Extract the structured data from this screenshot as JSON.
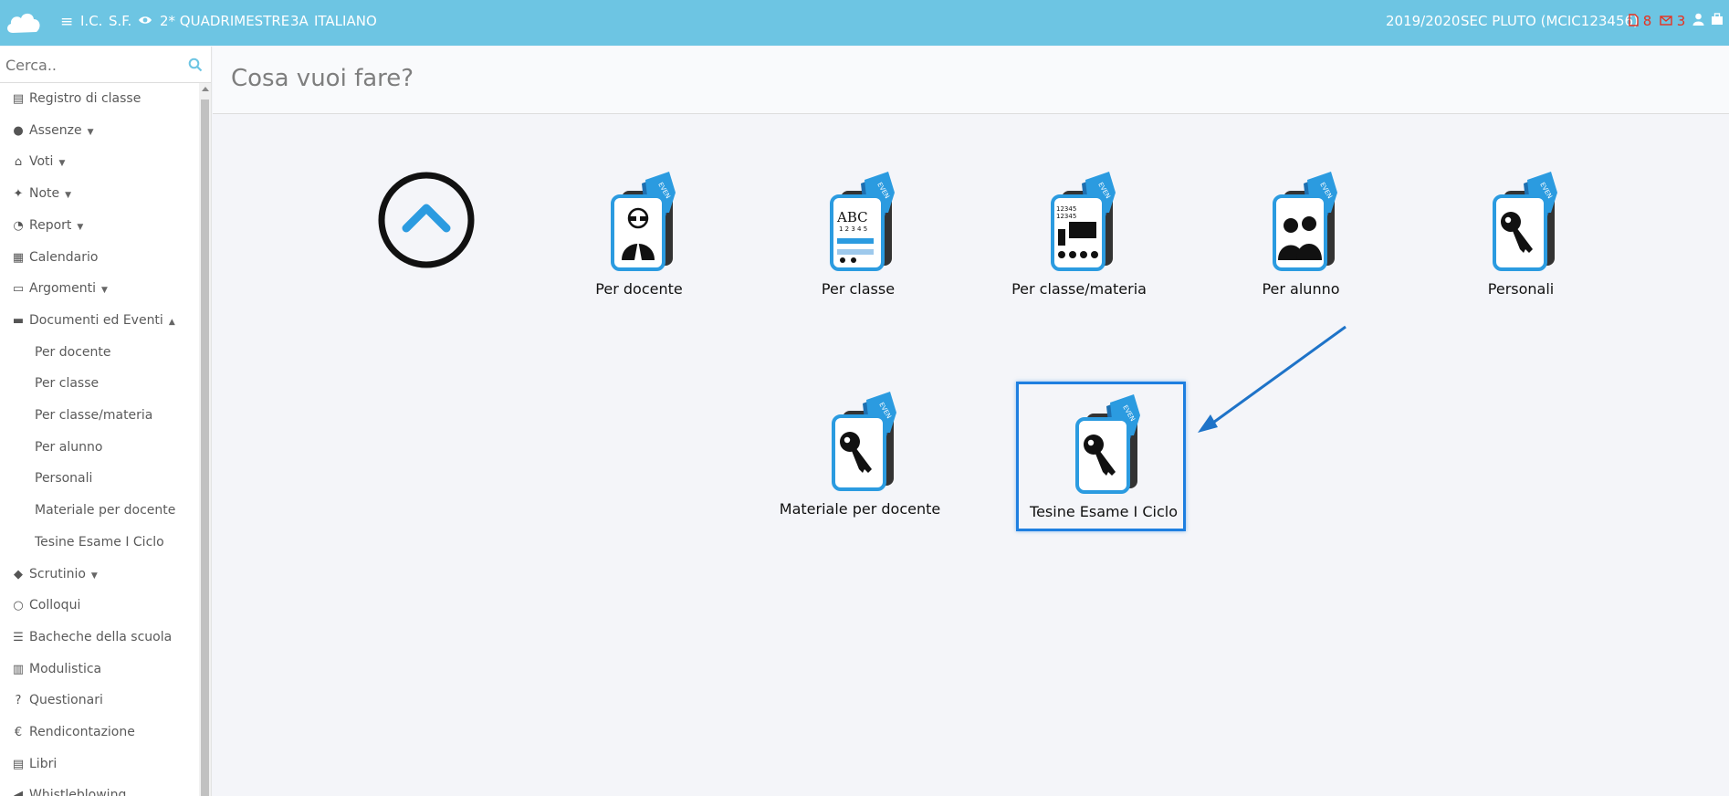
{
  "topbar": {
    "school": "I.C.",
    "branch": "S.F.",
    "period": "2* QUADRIMESTRE",
    "class": "3A",
    "subject": "ITALIANO",
    "year": "2019/2020",
    "user": "SEC PLUTO (MCIC123456)",
    "docs_count": "8",
    "mail_count": "3"
  },
  "search": {
    "placeholder": "Cerca.."
  },
  "sidebar": {
    "items": [
      {
        "label": "Registro di classe",
        "icon": "book-icon"
      },
      {
        "label": "Assenze",
        "icon": "user-icon",
        "caret": "▼"
      },
      {
        "label": "Voti",
        "icon": "bank-icon",
        "caret": "▼"
      },
      {
        "label": "Note",
        "icon": "pin-icon",
        "caret": "▼"
      },
      {
        "label": "Report",
        "icon": "pie-chart-icon",
        "caret": "▼"
      },
      {
        "label": "Calendario",
        "icon": "calendar-icon"
      },
      {
        "label": "Argomenti",
        "icon": "folder-open-icon",
        "caret": "▼"
      },
      {
        "label": "Documenti ed Eventi",
        "icon": "archive-icon",
        "caret": "▲"
      },
      {
        "label": "Per docente",
        "sub": true
      },
      {
        "label": "Per classe",
        "sub": true
      },
      {
        "label": "Per classe/materia",
        "sub": true
      },
      {
        "label": "Per alunno",
        "sub": true
      },
      {
        "label": "Personali",
        "sub": true
      },
      {
        "label": "Materiale per docente",
        "sub": true
      },
      {
        "label": "Tesine Esame I Ciclo",
        "sub": true
      },
      {
        "label": "Scrutinio",
        "icon": "graduation-cap-icon",
        "caret": "▼"
      },
      {
        "label": "Colloqui",
        "icon": "comments-icon"
      },
      {
        "label": "Bacheche della scuola",
        "icon": "list-alt-icon"
      },
      {
        "label": "Modulistica",
        "icon": "file-archive-icon"
      },
      {
        "label": "Questionari",
        "icon": "question-icon"
      },
      {
        "label": "Rendicontazione",
        "icon": "euro-icon"
      },
      {
        "label": "Libri",
        "icon": "book-icon"
      },
      {
        "label": "Whistleblowing",
        "icon": "megaphone-icon"
      }
    ]
  },
  "main": {
    "title": "Cosa vuoi fare?",
    "tiles": [
      {
        "label": "Per docente",
        "icon": "teacher-icon"
      },
      {
        "label": "Per classe",
        "icon": "abc-class-icon"
      },
      {
        "label": "Per classe/materia",
        "icon": "blackboard-icon"
      },
      {
        "label": "Per alunno",
        "icon": "students-icon"
      },
      {
        "label": "Personali",
        "icon": "key-icon"
      },
      {
        "label": "Materiale per docente",
        "icon": "key-icon"
      },
      {
        "label": "Tesine Esame I Ciclo",
        "icon": "key-icon"
      }
    ]
  },
  "colors": {
    "topbar": "#6dc5e3",
    "accent_blue": "#1e7fe0",
    "icon_blue": "#2b9be0",
    "badge_red": "#e8311f"
  }
}
